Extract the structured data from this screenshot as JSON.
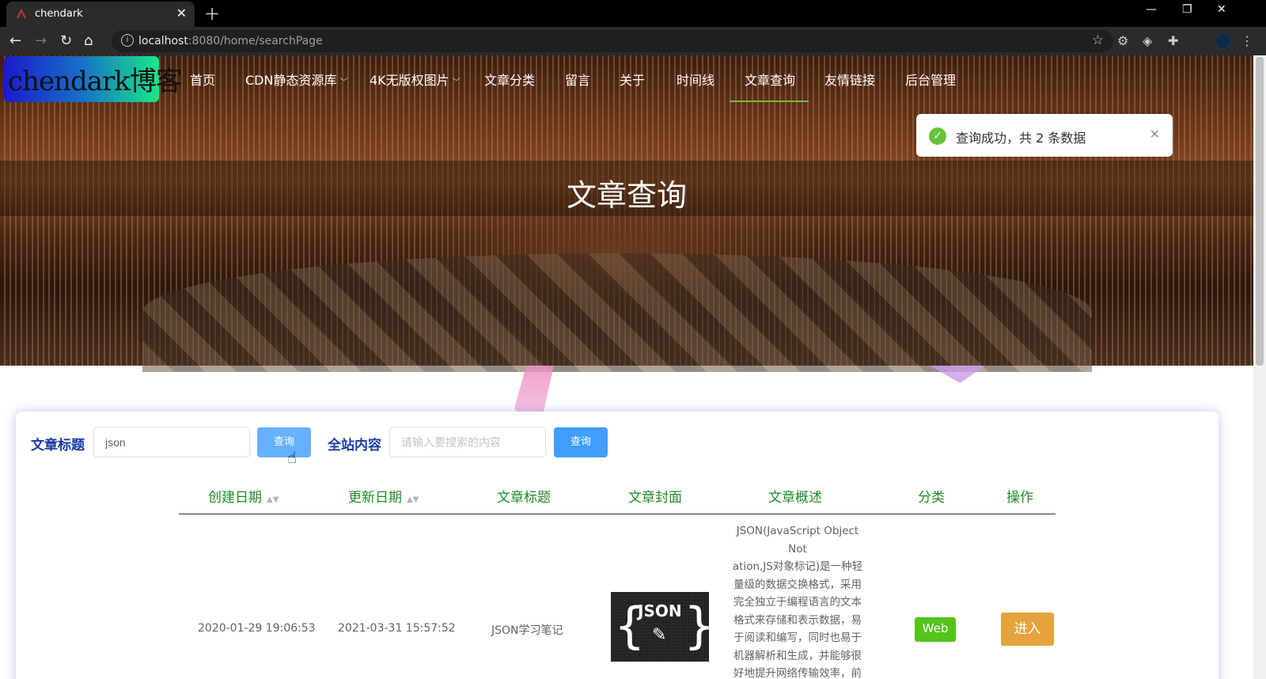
{
  "browser": {
    "tab_title": "chendark",
    "url_host": "localhost",
    "url_rest": ":8080/home/searchPage"
  },
  "nav": {
    "logo": "chendark博客",
    "items": [
      "首页",
      "CDN静态资源库",
      "4K无版权图片",
      "文章分类",
      "留言",
      "关于",
      "时间线",
      "文章查询",
      "友情链接",
      "后台管理"
    ],
    "active": "文章查询"
  },
  "hero": {
    "title": "文章查询"
  },
  "toast": {
    "message": "查询成功，共 2 条数据"
  },
  "search": {
    "title_label": "文章标题",
    "title_value": "json",
    "title_button": "查询",
    "content_label": "全站内容",
    "content_placeholder": "请输入要搜索的内容",
    "content_button": "查询"
  },
  "table": {
    "columns": [
      "创建日期",
      "更新日期",
      "文章标题",
      "文章封面",
      "文章概述",
      "分类",
      "操作"
    ],
    "rows": [
      {
        "created": "2020-01-29 19:06:53",
        "updated": "2021-03-31 15:57:52",
        "title": "JSON学习笔记",
        "cover_text": "JSON",
        "summary_lines": [
          "JSON(JavaScript Object Not",
          "ation,JS对象标记)是一种轻",
          "量级的数据交换格式，采用",
          "完全独立于编程语言的文本",
          "格式来存储和表示数据，易",
          "于阅读和编写，同时也易于",
          "机器解析和生成，并能够很",
          "好地提升网络传输效率，前"
        ],
        "category": "Web",
        "action": "进入"
      }
    ]
  },
  "colors": {
    "accent": "#409eff",
    "success": "#67c23a",
    "warning": "#e6a23c",
    "header_text": "#1f8a2a"
  }
}
